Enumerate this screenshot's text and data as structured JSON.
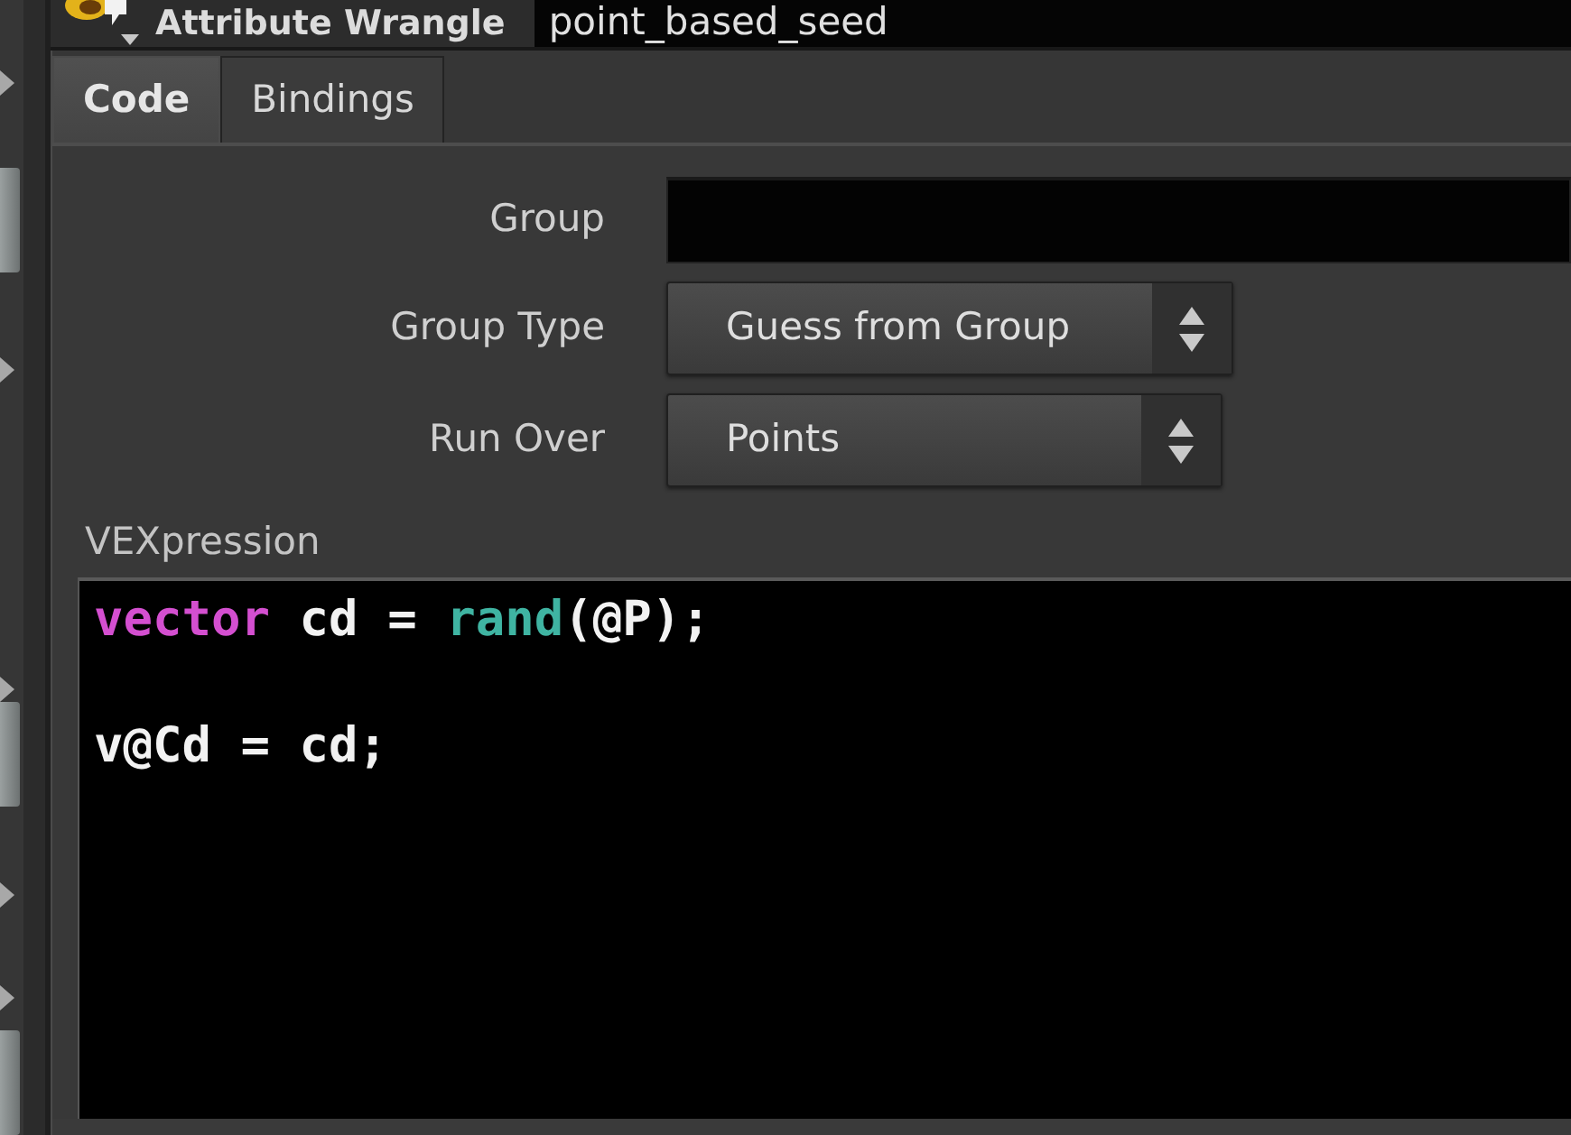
{
  "header": {
    "node_type": "Attribute Wrangle",
    "node_name": "point_based_seed"
  },
  "tabs": [
    {
      "label": "Code",
      "selected": true
    },
    {
      "label": "Bindings",
      "selected": false
    }
  ],
  "parameters": [
    {
      "kind": "text",
      "label": "Group"
    },
    {
      "kind": "menu",
      "label": "Group Type",
      "value": "Guess from Group"
    },
    {
      "kind": "menu",
      "label": "Run Over",
      "value": "Points"
    }
  ],
  "code_editor": {
    "label": "VEXpression",
    "lines": [
      {
        "kind": "code",
        "tokens": [
          {
            "kind": "keyword",
            "text": "vector"
          },
          {
            "kind": "plain",
            "text": " cd = "
          },
          {
            "kind": "function",
            "text": "rand"
          },
          {
            "kind": "plain",
            "text": "(@P);"
          }
        ]
      },
      {
        "kind": "blank"
      },
      {
        "kind": "code",
        "tokens": [
          {
            "kind": "plain",
            "text": "v@Cd = cd;"
          }
        ]
      }
    ]
  }
}
